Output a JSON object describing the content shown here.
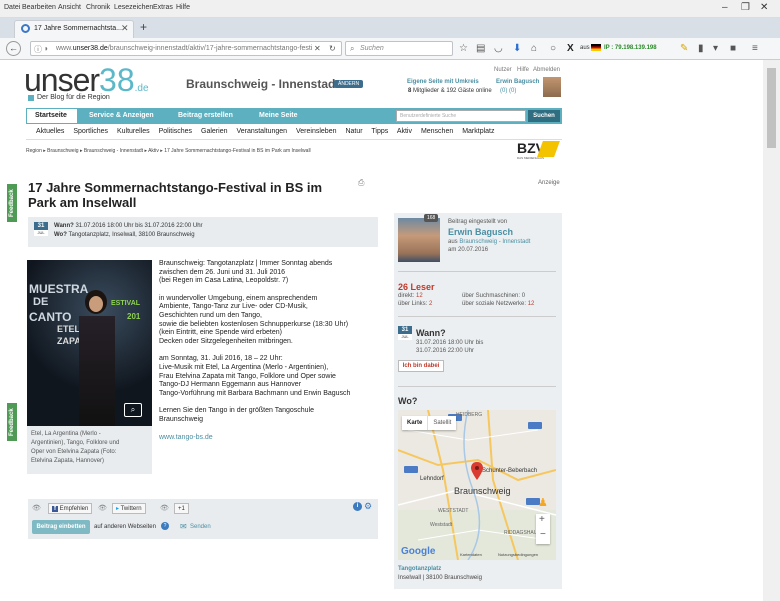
{
  "browser": {
    "menu": [
      "Datei",
      "Bearbeiten",
      "Ansicht",
      "Chronik",
      "Lesezeichen",
      "Extras",
      "Hilfe"
    ],
    "tab_title": "17 Jahre Sommernachtsta...",
    "url_prefix": "www.",
    "url_domain": "unser38.de",
    "url_path": "/braunschweig-innenstadt/aktiv/17-jahre-sommernachtstango-festi",
    "search_placeholder": "Suchen",
    "ip_label": "aus",
    "ip_text": "IP : 79.198.139.198"
  },
  "site": {
    "logo_word": "unser",
    "logo_number": "38",
    "logo_tld": ".de",
    "tagline": "Der Blog für die Region",
    "region": "Braunschweig - Innenstadt",
    "region_badge": "ÄNDERN",
    "top_links": [
      "Nutzer",
      "Hilfe",
      "Abmelden"
    ],
    "own_page": "Eigene Seite mit Umkreis",
    "members_text": "Mitglieder & 192 Gäste online",
    "members_count": "8",
    "user_name": "Erwin Bagusch",
    "user_counts": "(0)  (0)",
    "main_nav": [
      "Startseite",
      "Service & Anzeigen",
      "Beitrag erstellen",
      "Meine Seite"
    ],
    "site_search_placeholder": "Benutzerdefinierte Suche",
    "site_search_button": "Suchen",
    "sub_nav": [
      "Aktuelles",
      "Sportliches",
      "Kulturelles",
      "Politisches",
      "Galerien",
      "Veranstaltungen",
      "Vereinsleben",
      "Natur",
      "Tipps",
      "Aktiv",
      "Menschen",
      "Marktplatz"
    ],
    "breadcrumb": [
      "Region",
      "Braunschweig",
      "Braunschweig - Innenstadt",
      "Aktiv",
      "17 Jahre Sommernachtstango-Festival in BS im Park am Inselwall"
    ],
    "partner_logo": "BZV",
    "partner_sub": "DAS MEDIENHAUS"
  },
  "article": {
    "title_line1": "17 Jahre Sommernachtstango-Festival in BS im",
    "title_line2": "Park am Inselwall",
    "ad_label": "Anzeige",
    "date_day": "31",
    "date_month": "JUL",
    "when_label": "Wann?",
    "when_value": "31.07.2016 18:00 Uhr bis 31.07.2016 22:00 Uhr",
    "where_label": "Wo?",
    "where_value": "Tangotanzplatz, Inselwall, 38100 Braunschweig",
    "image_texts": [
      "MUESTRA",
      "DE",
      "CANTO",
      "ETELVI",
      "ZAPAT",
      "ESTIVAL",
      "201"
    ],
    "caption": [
      "Etel, La Argentina (Merlo -",
      "Argentinien), Tango, Folklore und",
      "Oper von Etelvina Zapata (Foto:",
      "Etelvina Zapata, Hannover)"
    ],
    "paragraphs": [
      [
        "Braunschweig: Tangotanzplatz | Immer Sonntag abends",
        "zwischen dem 26. Juni und 31. Juli 2016",
        "(bei Regen im Casa Latina, Leopoldstr. 7)"
      ],
      [
        "in wundervoller Umgebung, einem ansprechendem",
        "Ambiente, Tango-Tanz zur Live- oder CD-Musik,",
        "Geschichten rund um den Tango,",
        "sowie die beliebten kostenlosen Schnupperkurse (18:30 Uhr)",
        "(kein Eintritt, eine Spende wird erbeten)",
        "Decken oder Sitzgelegenheiten mitbringen."
      ],
      [
        "am Sonntag, 31. Juli 2016, 18 – 22 Uhr:",
        "Live-Musik mit Etel, La Argentina (Merlo - Argentinien),",
        "Frau Etelvina Zapata mit Tango, Folklore und Oper sowie",
        "Tango-DJ Hermann Eggemann aus Hannover",
        "Tango-Vorführung mit Barbara Bachmann und Erwin Bagusch"
      ],
      [
        "Lernen Sie den Tango in der größten Tangoschule",
        "Braunschweig"
      ]
    ],
    "link": "www.tango-bs.de",
    "share_buttons": [
      "Empfehlen",
      "Twittern",
      "+1"
    ],
    "embed_button": "Beitrag einbetten",
    "embed_text": "auf anderen Webseiten",
    "send_label": "Senden"
  },
  "sidebar": {
    "badge": "168",
    "posted_by_label": "Beitrag eingestellt von",
    "author": "Erwin Bagusch",
    "from_prefix": "aus",
    "from_location": "Braunschweig - Innenstadt",
    "posted_date": "am 20.07.2016",
    "readers": "26 Leser",
    "stats": [
      {
        "label": "direkt:",
        "value": "12"
      },
      {
        "label": "über Suchmaschinen:",
        "value": "0"
      },
      {
        "label": "über Links:",
        "value": "2"
      },
      {
        "label": "über soziale Netzwerke:",
        "value": "12"
      }
    ],
    "when_day": "31",
    "when_month": "JUL",
    "when_label": "Wann?",
    "when_lines": [
      "31.07.2016 18:00 Uhr bis",
      "31.07.2016 22:00 Uhr"
    ],
    "attend_button": "Ich bin dabei",
    "where_label": "Wo?",
    "map_tabs": [
      "Karte",
      "Satellit"
    ],
    "map_labels": [
      "Schunter-Beberbach",
      "Lehndorf",
      "Braunschweig",
      "WESTSTADT",
      "HEIDBERG",
      "RIDDAGSHAUSEN",
      "Weststadt"
    ],
    "map_google": "Google",
    "map_footer": [
      "Kartendaten",
      "Nutzungsbedingungen"
    ],
    "place_name": "Tangotanzplatz",
    "place_address": "Inselwall | 38100 Braunschweig"
  },
  "feedback_label": "Feedback"
}
